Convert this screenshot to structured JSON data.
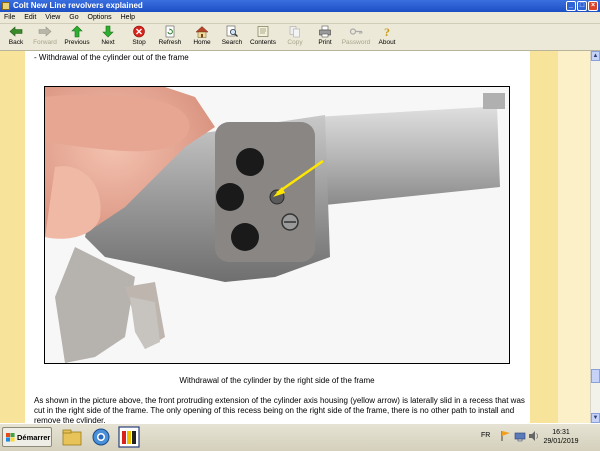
{
  "window": {
    "title": "Colt New Line revolvers explained",
    "controls": {
      "minimize": "_",
      "maximize": "□",
      "close": "×"
    }
  },
  "menu": {
    "items": [
      "File",
      "Edit",
      "View",
      "Go",
      "Options",
      "Help"
    ]
  },
  "toolbar": {
    "buttons": [
      {
        "label": "Back",
        "icon": "back-arrow-icon",
        "enabled": true
      },
      {
        "label": "Forward",
        "icon": "forward-arrow-icon",
        "enabled": false
      },
      {
        "label": "Previous",
        "icon": "previous-up-arrow-icon",
        "enabled": true
      },
      {
        "label": "Next",
        "icon": "next-down-arrow-icon",
        "enabled": true
      },
      {
        "label": "Stop",
        "icon": "stop-icon",
        "enabled": true
      },
      {
        "label": "Refresh",
        "icon": "refresh-icon",
        "enabled": true
      },
      {
        "label": "Home",
        "icon": "home-icon",
        "enabled": true
      },
      {
        "label": "Search",
        "icon": "search-icon",
        "enabled": true
      },
      {
        "label": "Contents",
        "icon": "contents-icon",
        "enabled": true
      },
      {
        "label": "Copy",
        "icon": "copy-icon",
        "enabled": false
      },
      {
        "label": "Print",
        "icon": "print-icon",
        "enabled": true
      },
      {
        "label": "Password",
        "icon": "key-icon",
        "enabled": false
      },
      {
        "label": "About",
        "icon": "about-icon",
        "enabled": true
      }
    ]
  },
  "content": {
    "section_title": "- Withdrawal of the cylinder out of the frame",
    "caption": "Withdrawal of the cylinder by the right side of the frame",
    "body_text": "As shown in the picture above, the front protruding extension of the cylinder axis housing (yellow arrow) is laterally slid in a recess that was cut in the right side of the frame. The only opening of this recess being on the right side of the frame, there is no other path to install and remove the cylinder."
  },
  "taskbar": {
    "start_label": "Démarrer",
    "language": "FR",
    "time": "16:31",
    "date": "29/01/2019"
  },
  "colors": {
    "margin_yellow": "#f8e39a",
    "margin_light": "#fbf0c8",
    "titlebar_blue": "#1c4fc4",
    "arrow_yellow": "#ffe600"
  }
}
